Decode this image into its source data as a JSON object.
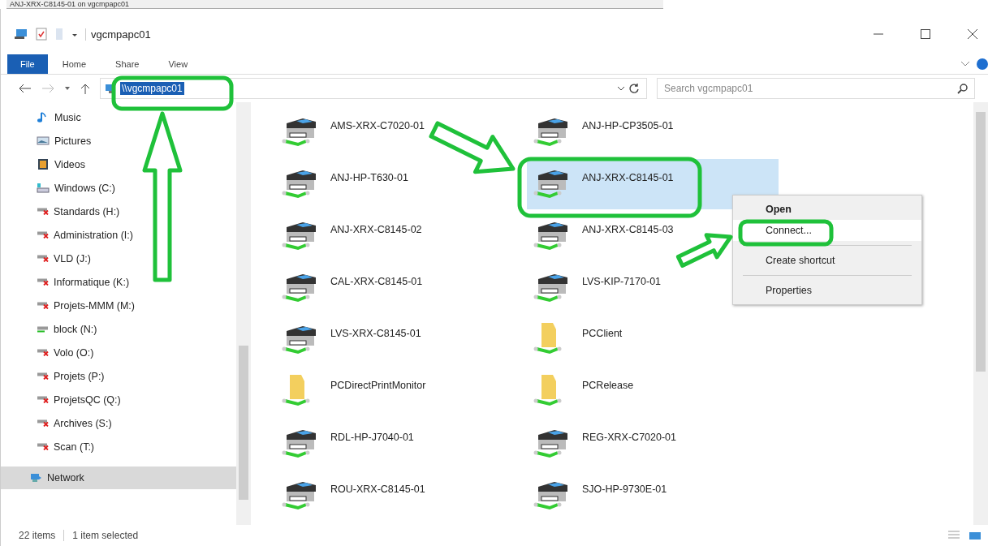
{
  "banner": {
    "text": "ANJ-XRX-C8145-01 on vgcmpapc01"
  },
  "window": {
    "title": "vgcmpapc01"
  },
  "ribbon_tabs": [
    {
      "label": "File",
      "selected": true
    },
    {
      "label": "Home",
      "selected": false
    },
    {
      "label": "Share",
      "selected": false
    },
    {
      "label": "View",
      "selected": false
    }
  ],
  "address_bar": {
    "path": "\\\\vgcmpapc01"
  },
  "search": {
    "placeholder": "Search vgcmpapc01"
  },
  "sidebar": {
    "items": [
      {
        "label": "Music",
        "kind": "music",
        "selected": false
      },
      {
        "label": "Pictures",
        "kind": "pictures",
        "selected": false
      },
      {
        "label": "Videos",
        "kind": "videos",
        "selected": false
      },
      {
        "label": "Windows (C:)",
        "kind": "drive",
        "selected": false
      },
      {
        "label": "Standards (H:)",
        "kind": "disconnected",
        "selected": false
      },
      {
        "label": "Administration (I:)",
        "kind": "disconnected",
        "selected": false
      },
      {
        "label": "VLD (J:)",
        "kind": "disconnected",
        "selected": false
      },
      {
        "label": "Informatique (K:)",
        "kind": "disconnected",
        "selected": false
      },
      {
        "label": "Projets-MMM (M:)",
        "kind": "disconnected",
        "selected": false
      },
      {
        "label": "block (N:)",
        "kind": "netdrive",
        "selected": false
      },
      {
        "label": "Volo (O:)",
        "kind": "disconnected",
        "selected": false
      },
      {
        "label": "Projets (P:)",
        "kind": "disconnected",
        "selected": false
      },
      {
        "label": "ProjetsQC (Q:)",
        "kind": "disconnected",
        "selected": false
      },
      {
        "label": "Archives (S:)",
        "kind": "disconnected",
        "selected": false
      },
      {
        "label": "Scan (T:)",
        "kind": "disconnected",
        "selected": false
      },
      {
        "label": "Network",
        "kind": "network",
        "selected": true
      }
    ]
  },
  "items": [
    {
      "name": "AMS-XRX-C7020-01",
      "kind": "printer",
      "selected": false
    },
    {
      "name": "ANJ-HP-CP3505-01",
      "kind": "printer",
      "selected": false
    },
    {
      "name": "ANJ-HP-T630-01",
      "kind": "printer",
      "selected": false
    },
    {
      "name": "ANJ-XRX-C8145-01",
      "kind": "printer",
      "selected": true
    },
    {
      "name": "ANJ-XRX-C8145-02",
      "kind": "printer",
      "selected": false
    },
    {
      "name": "ANJ-XRX-C8145-03",
      "kind": "printer",
      "selected": false
    },
    {
      "name": "CAL-XRX-C8145-01",
      "kind": "printer",
      "selected": false
    },
    {
      "name": "LVS-KIP-7170-01",
      "kind": "printer",
      "selected": false
    },
    {
      "name": "LVS-XRX-C8145-01",
      "kind": "printer",
      "selected": false
    },
    {
      "name": "PCClient",
      "kind": "share",
      "selected": false
    },
    {
      "name": "PCDirectPrintMonitor",
      "kind": "share",
      "selected": false
    },
    {
      "name": "PCRelease",
      "kind": "share",
      "selected": false
    },
    {
      "name": "RDL-HP-J7040-01",
      "kind": "printer",
      "selected": false
    },
    {
      "name": "REG-XRX-C7020-01",
      "kind": "printer",
      "selected": false
    },
    {
      "name": "ROU-XRX-C8145-01",
      "kind": "printer",
      "selected": false
    },
    {
      "name": "SJO-HP-9730E-01",
      "kind": "printer",
      "selected": false
    }
  ],
  "context_menu": {
    "items": [
      {
        "label": "Open",
        "default": true,
        "selected": false
      },
      {
        "label": "Connect...",
        "default": false,
        "selected": true
      },
      {
        "label": "Create shortcut",
        "default": false,
        "selected": false
      },
      {
        "label": "Properties",
        "default": false,
        "selected": false
      }
    ]
  },
  "status_bar": {
    "count": "22 items",
    "selection": "1 item selected"
  }
}
